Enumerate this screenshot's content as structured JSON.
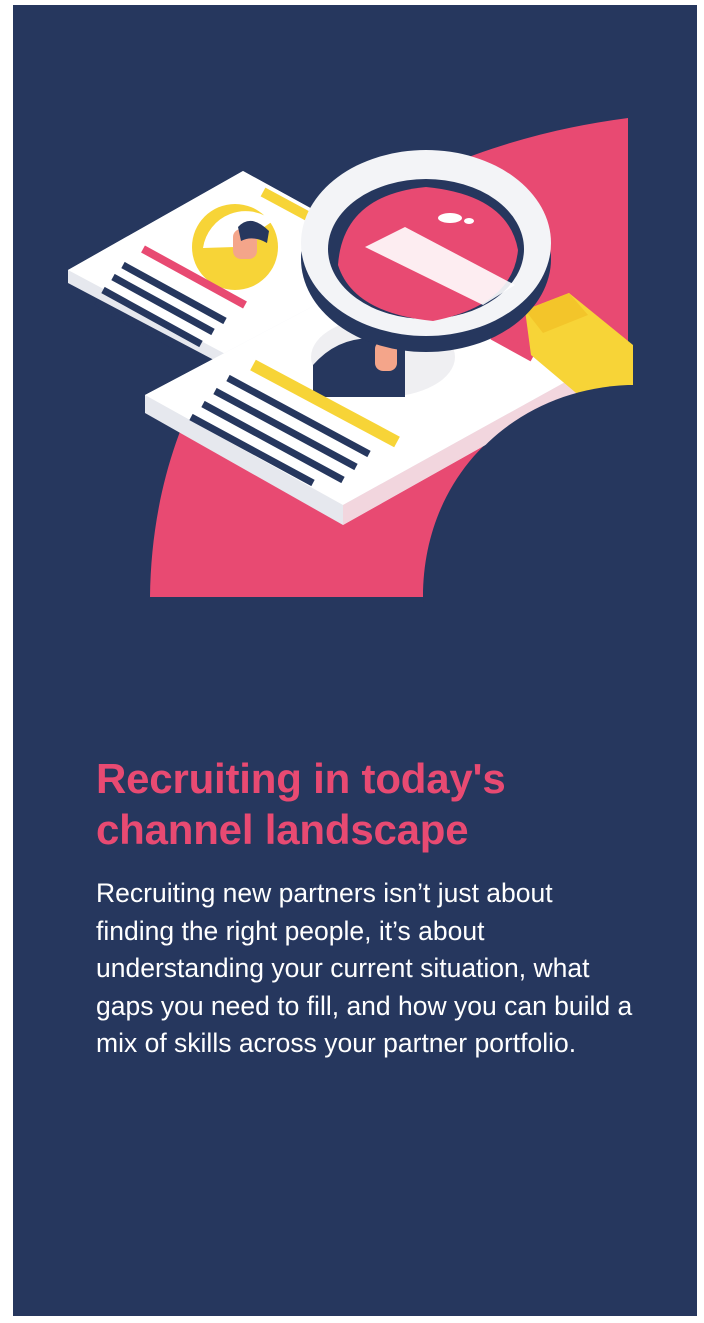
{
  "article": {
    "title": "Recruiting in today's channel landscape",
    "body": "Recruiting new partners isn’t just about finding the right people, it’s about understanding your current situation, what gaps you need to fill, and how you can build a mix of skills across your partner portfolio."
  },
  "illustration": {
    "icon": "resume-magnifier-illustration"
  },
  "colors": {
    "background": "#26375e",
    "accent_pink": "#e84a72",
    "accent_yellow": "#f7d437",
    "paper": "#ffffff",
    "text": "#ffffff"
  }
}
